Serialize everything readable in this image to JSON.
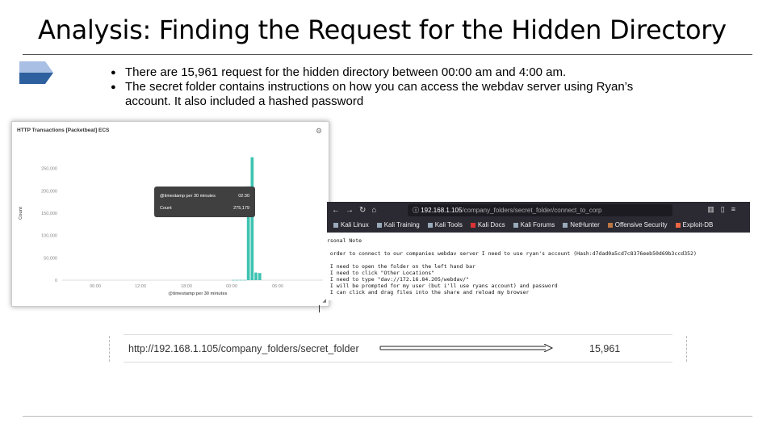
{
  "slide": {
    "title": "Analysis: Finding the Request for the Hidden Directory",
    "bullets": [
      "There are 15,961 request for the hidden directory between 00:00 am and  4:00 am.",
      "The secret folder contains instructions on how you can access the webdav server using Ryan’s account. It also included a hashed password"
    ],
    "colors": {
      "badge_light": "#a9bfe3",
      "badge_dark": "#2e5f9e"
    }
  },
  "kibana": {
    "title": "HTTP Transactions [Packetbeat] ECS",
    "gear_icon": "gear-icon",
    "tooltip": {
      "key_label": "@timestamp per 30 minutes",
      "key_value": "02:30",
      "count_label": "Count",
      "count_value": "275,179"
    }
  },
  "chart_data": {
    "type": "bar",
    "xlabel": "@timestamp per 30 minutes",
    "ylabel": "Count",
    "ylim": [
      0,
      300000
    ],
    "yticks": [
      "0",
      "50,000",
      "100,000",
      "150,000",
      "200,000",
      "250,000"
    ],
    "xticks": [
      "06:00",
      "12:00",
      "18:00",
      "00:00",
      "06:00"
    ],
    "color": "#3ec3b2",
    "series": [
      {
        "categories": [
          "00:00",
          "00:30",
          "01:00",
          "01:30",
          "02:00",
          "02:30",
          "03:00",
          "03:30"
        ],
        "values": [
          500,
          500,
          500,
          500,
          210000,
          275179,
          17000,
          16000
        ]
      }
    ]
  },
  "browser": {
    "url_host": "192.168.1.105",
    "url_path": "/company_folders/secret_folder/connect_to_corp",
    "bookmarks": [
      "Kali Linux",
      "Kali Training",
      "Kali Tools",
      "Kali Docs",
      "Kali Forums",
      "NetHunter",
      "Offensive Security",
      "Exploit-DB"
    ],
    "page_lines": [
      "rsonal Note",
      "",
      " order to connect to our companies webdav server I need to use ryan's account (Hash:d7dad0a5cd7c8376eeb50d69b3ccd352)",
      "",
      " I need to open the folder on the left hand bar",
      " I need to click \"Other Locations\"",
      " I need to type \"dav://172.16.84.205/webdav/\"",
      " I will be prompted for my user (but i'll use ryans account) and password",
      " I can click and drag files into the share and reload my browser"
    ]
  },
  "result_row": {
    "url": "http://192.168.1.105/company_folders/secret_folder",
    "count": "15,961"
  }
}
